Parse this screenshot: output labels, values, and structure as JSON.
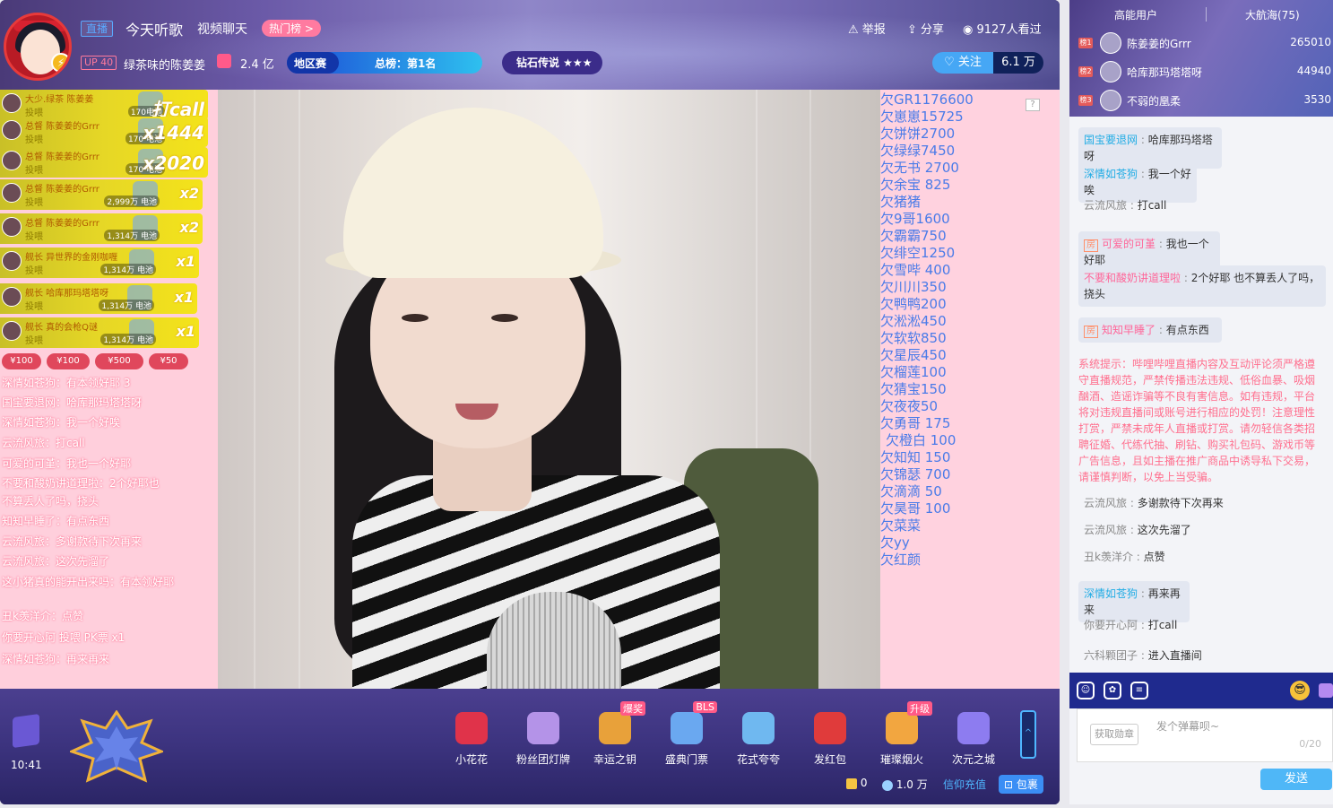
{
  "header": {
    "live_tag": "直播",
    "title": "今天听歌",
    "category": "视频聊天",
    "hot_rank": "热门榜 >",
    "up_level": "UP 40",
    "uploader": "绿茶味的陈姜姜",
    "popularity": "2.4 亿",
    "area_tag": "地区赛",
    "total_rank": "总榜：第1名",
    "diamond": "钻石传说 ★★★",
    "report": "举报",
    "share": "分享",
    "viewers": "9127人看过",
    "follow": "关注",
    "fans": "6.1 万"
  },
  "gift_rows": [
    {
      "user": "大少.绿茶 陈姜姜",
      "action": "投喂",
      "price": "170电池",
      "combo": "打call"
    },
    {
      "user": "总督 陈姜姜的Grrr",
      "action": "投喂",
      "price": "170 电池",
      "combo": "x1444"
    },
    {
      "user": "总督 陈姜姜的Grrr",
      "action": "投喂",
      "price": "170 电池",
      "combo": "x2020"
    },
    {
      "user": "总督 陈姜姜的Grrr",
      "action": "投喂",
      "price": "2,999万 电池",
      "combo": "x2"
    },
    {
      "user": "总督 陈姜姜的Grrr",
      "action": "投喂",
      "price": "1,314万 电池",
      "combo": "x2"
    },
    {
      "user": "舰长 异世界的金刚咖喱",
      "action": "投喂",
      "price": "1,314万 电池",
      "combo": "x1"
    },
    {
      "user": "舰长 哈库那玛塔塔呀",
      "action": "投喂",
      "price": "1,314万 电池",
      "combo": "x1"
    },
    {
      "user": "舰长 真的会枪Q谜",
      "action": "投喂",
      "price": "1,314万 电池",
      "combo": "x1"
    }
  ],
  "superchats": [
    "¥100",
    "¥100",
    "¥500",
    "¥50"
  ],
  "left_danmaku": [
    "深情如苍狗：有本领好耶 3",
    "国宝要退网：哈库那玛塔塔呀",
    "深情如苍狗：我一个好唉",
    "云流风旅：打call",
    "可爱的可堇：我也一个好耶",
    "不要和酸奶讲道理啦：2个好耶也",
    "不算丢人了吗，挠头",
    "知知早睡了：有点东西",
    "云流风旅：多谢款待下次再来",
    "云流风旅：这次先溜了",
    "这小猪真的能开出来吗：有本领好耶",
    "丑k羡洋介：点赞",
    "你要开心阿 投喂 PK票 x1",
    "深情如苍狗：再来再来"
  ],
  "rank_list": [
    "欠GR1176600",
    "欠崽崽15725",
    "欠饼饼2700",
    "欠绿绿7450",
    "欠无书 2700",
    "欠余宝 825",
    "欠猪猪",
    "欠9哥1600",
    "欠霸霸750",
    "欠绯空1250",
    "欠雪哔 400",
    "欠川川350",
    "欠鸭鸭200",
    "欠淞淞450",
    "欠软软850",
    "欠星辰450",
    "欠榴莲100",
    "欠猜宝150",
    "欠夜夜50",
    "欠勇哥 175",
    "欠橙白 100",
    "欠知知 150",
    "欠锦瑟 700",
    "欠滴滴 50",
    "欠昊哥 100",
    "欠菜菜",
    "欠yy",
    "欠红颜"
  ],
  "rank_help": "?",
  "bottom": {
    "time": "10:41",
    "gifts": [
      {
        "label": "小花花",
        "badge": "",
        "color": "#e0334a"
      },
      {
        "label": "粉丝团灯牌",
        "badge": "",
        "color": "#b493e8"
      },
      {
        "label": "幸运之钥",
        "badge": "爆奖",
        "color": "#e8a13a"
      },
      {
        "label": "盛典门票",
        "badge": "BLS",
        "color": "#6aa8f0"
      },
      {
        "label": "花式夸夸",
        "badge": "",
        "color": "#6fb8f0"
      },
      {
        "label": "发红包",
        "badge": "",
        "color": "#e03b3b"
      },
      {
        "label": "璀璨烟火",
        "badge": "升级",
        "color": "#f2a640"
      },
      {
        "label": "次元之城",
        "badge": "",
        "color": "#8d7cf0"
      }
    ],
    "scroll_hint": "^",
    "coins": "0",
    "battery": "1.0 万",
    "recharge": "信仰充值",
    "package": "包裹"
  },
  "side": {
    "tab_high": "高能用户",
    "tab_fleet": "大航海(75)",
    "top_users": [
      {
        "rank": "榜1",
        "name": "陈姜姜的Grrr",
        "value": "265010"
      },
      {
        "rank": "榜2",
        "name": "哈库那玛塔塔呀",
        "value": "44940"
      },
      {
        "rank": "榜3",
        "name": "不弱的凰柔",
        "value": "3530"
      }
    ],
    "chat": [
      {
        "user": "国宝要退网",
        "text": "哈库那玛塔塔呀",
        "style": "b"
      },
      {
        "user": "深情如苍狗",
        "text": "我一个好唉",
        "style": "b"
      },
      {
        "user": "云流风旅",
        "text": "打call",
        "style": "g"
      },
      {
        "user": "可爱的可堇",
        "text": "我也一个好耶",
        "style": "p"
      },
      {
        "user": "不要和酸奶讲道理啦",
        "text": "2个好耶 也不算丢人了吗，挠头",
        "style": "p"
      },
      {
        "user": "知知早睡了",
        "text": "有点东西",
        "style": "p"
      },
      {
        "user": "云流风旅",
        "text": "多谢款待下次再来",
        "style": "g"
      },
      {
        "user": "云流风旅",
        "text": "这次先溜了",
        "style": "g"
      },
      {
        "user": "丑k羡洋介",
        "text": "点赞",
        "style": "g"
      },
      {
        "user": "深情如苍狗",
        "text": "再来再来",
        "style": "b"
      },
      {
        "user": "你要开心阿",
        "text": "打call",
        "style": "g"
      },
      {
        "user": "六科颗团子",
        "text": "进入直播间",
        "style": "g"
      }
    ],
    "system_notice": "系统提示：哔哩哔哩直播内容及互动评论须严格遵守直播规范，严禁传播违法违规、低俗血暴、吸烟酗酒、造谣诈骗等不良有害信息。如有违规，平台将对违规直播间或账号进行相应的处罚！注意理性打赏，严禁未成年人直播或打赏。请勿轻信各类招聘征婚、代练代抽、刷钻、购买礼包码、游戏币等广告信息，且如主播在推广商品中诱导私下交易，请谨慎判断，以免上当受骗。",
    "medal": "获取勋章",
    "placeholder": "发个弹幕呗~",
    "counter": "0/20",
    "send": "发送"
  }
}
